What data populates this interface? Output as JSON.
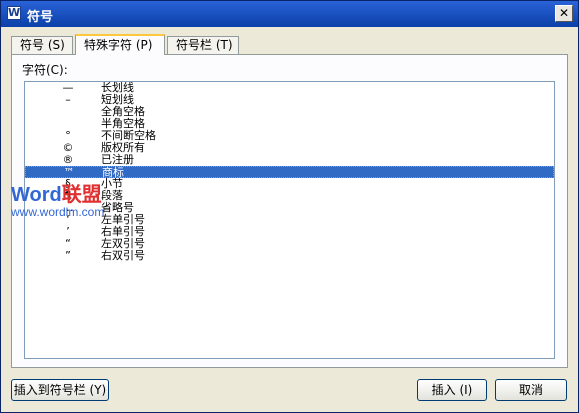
{
  "window": {
    "title": "符号",
    "app_icon_glyph": "W"
  },
  "tabs": [
    {
      "label": "符号 (S)",
      "active": false
    },
    {
      "label": "特殊字符 (P)",
      "active": true
    },
    {
      "label": "符号栏 (T)",
      "active": false
    }
  ],
  "panel": {
    "char_label": "字符(C):"
  },
  "chars": [
    {
      "symbol": "—",
      "name": "长划线"
    },
    {
      "symbol": "–",
      "name": "短划线"
    },
    {
      "symbol": "",
      "name": "全角空格"
    },
    {
      "symbol": "",
      "name": "半角空格"
    },
    {
      "symbol": "°",
      "name": "不间断空格"
    },
    {
      "symbol": "©",
      "name": "版权所有"
    },
    {
      "symbol": "®",
      "name": "已注册"
    },
    {
      "symbol": "™",
      "name": "商标",
      "selected": true
    },
    {
      "symbol": "§",
      "name": "小节"
    },
    {
      "symbol": "¶",
      "name": "段落"
    },
    {
      "symbol": "…",
      "name": "省略号"
    },
    {
      "symbol": "‘",
      "name": "左单引号"
    },
    {
      "symbol": "’",
      "name": "右单引号"
    },
    {
      "symbol": "“",
      "name": "左双引号"
    },
    {
      "symbol": "”",
      "name": "右双引号"
    }
  ],
  "watermark": {
    "logo_main": "Word",
    "logo_accent": "联盟",
    "url": "www.wordlm.com"
  },
  "buttons": {
    "insert_to_bar": "插入到符号栏 (Y)",
    "insert": "插入 (I)",
    "cancel": "取消"
  },
  "colors": {
    "titlebar": "#0b3fa8",
    "selection": "#316ac5",
    "tab_highlight": "#ffc83d"
  }
}
